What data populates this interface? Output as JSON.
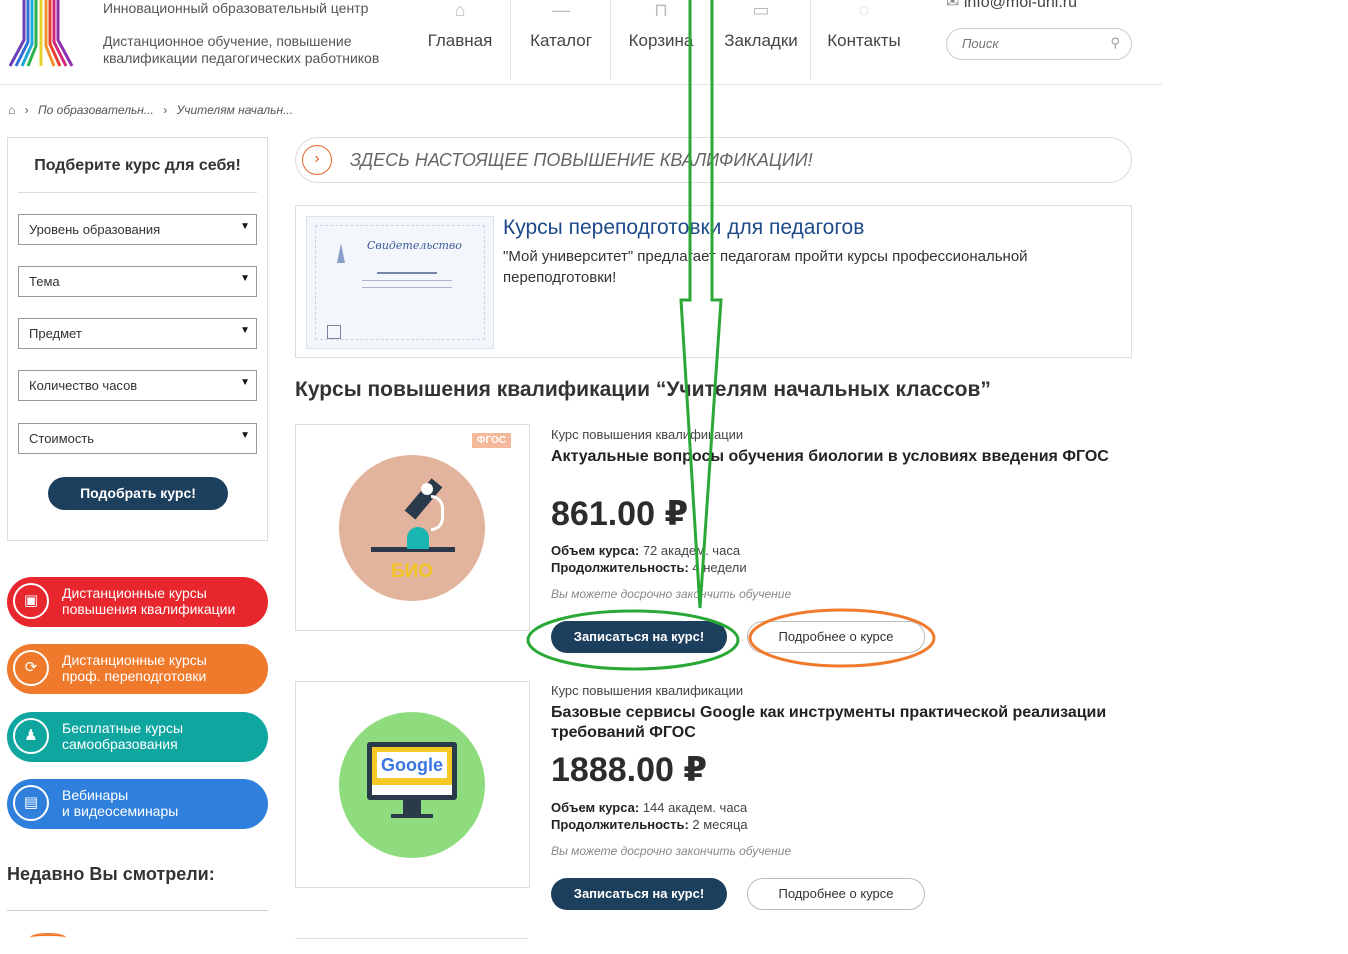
{
  "header": {
    "org_line1": "Инновационный образовательный центр",
    "org_line2": "Дистанционное обучение, повышение квалификации педагогических работников",
    "nav": [
      {
        "label": "Главная",
        "icon": "home-icon"
      },
      {
        "label": "Каталог",
        "icon": "catalog-icon"
      },
      {
        "label": "Корзина",
        "icon": "cart-icon"
      },
      {
        "label": "Закладки",
        "icon": "bookmark-icon"
      },
      {
        "label": "Контакты",
        "icon": "contacts-icon"
      }
    ],
    "email": "info@moi-uni.ru",
    "search_placeholder": "Поиск"
  },
  "breadcrumb": [
    "По образовательн...",
    "Учителям начальн..."
  ],
  "filter": {
    "title": "Подберите курс для себя!",
    "selects": [
      "Уровень образования",
      "Тема",
      "Предмет",
      "Количество часов",
      "Стоимость"
    ],
    "submit": "Подобрать курс!"
  },
  "categories": [
    {
      "line1": "Дистанционные курсы",
      "line2": "повышения квалификации",
      "color": "#e8262d"
    },
    {
      "line1": "Дистанционные курсы",
      "line2": "проф. переподготовки",
      "color": "#f07a2c"
    },
    {
      "line1": "Бесплатные курсы",
      "line2": "самообразования",
      "color": "#10a6a0"
    },
    {
      "line1": "Вебинары",
      "line2": "и видеосеминары",
      "color": "#2f80dc"
    }
  ],
  "recent_title": "Недавно Вы смотрели:",
  "slogan": "ЗДЕСЬ НАСТОЯЩЕЕ ПОВЫШЕНИЕ КВАЛИФИКАЦИИ!",
  "promo": {
    "title": "Курсы переподготовки для педагогов",
    "text": "\"Мой университет\" предлагает педагогам пройти курсы профессиональной переподготовки!",
    "cert_text": "Свидетельство"
  },
  "section_title": "Курсы повышения квалификации “Учителям начальных классов”",
  "courses": [
    {
      "type": "Курс повышения квалификации",
      "title": "Актуальные вопросы обучения биологии в условиях введения ФГОС",
      "price": "861.00 ₽",
      "volume_label": "Объем курса:",
      "volume": "72 академ. часа",
      "duration_label": "Продолжительность:",
      "duration": "4 недели",
      "note": "Вы можете досрочно закончить обучение",
      "badge": "ФГОС",
      "thumb_text": "БИО",
      "enroll": "Записаться на курс!",
      "details": "Подробнее о курсе"
    },
    {
      "type": "Курс повышения квалификации",
      "title": "Базовые сервисы Google как инструменты практической реализации требований ФГОС",
      "price": "1888.00 ₽",
      "volume_label": "Объем курса:",
      "volume": "144 академ. часа",
      "duration_label": "Продолжительность:",
      "duration": "2 месяца",
      "note": "Вы можете досрочно закончить обучение",
      "thumb_text": "Google",
      "enroll": "Записаться на курс!",
      "details": "Подробнее о курсе"
    }
  ],
  "annotation_colors": {
    "arrow": "#2aa836",
    "enroll_circle": "#2aa836",
    "details_circle": "#f07a2c"
  }
}
